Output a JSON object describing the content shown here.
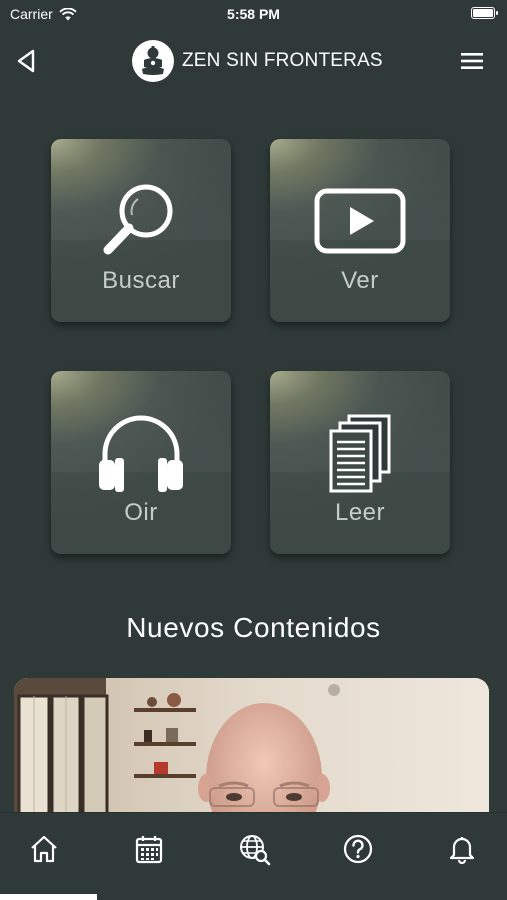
{
  "status_bar": {
    "carrier": "Carrier",
    "time": "5:58 PM"
  },
  "header": {
    "brand_title": "ZEN SIN FRONTERAS",
    "back_icon": "back-chevron-icon",
    "menu_icon": "hamburger-menu-icon"
  },
  "tiles": [
    {
      "label": "Buscar",
      "icon": "magnifier-icon"
    },
    {
      "label": "Ver",
      "icon": "play-icon"
    },
    {
      "label": "Oir",
      "icon": "headphones-icon"
    },
    {
      "label": "Leer",
      "icon": "documents-icon"
    }
  ],
  "section": {
    "title": "Nuevos Contenidos"
  },
  "tabbar": {
    "items": [
      "home-icon",
      "calendar-icon",
      "globe-search-icon",
      "help-icon",
      "bell-icon"
    ]
  },
  "colors": {
    "background": "#2f3a38",
    "tile_label": "#c7cccb",
    "tile_glow": "#a8ac8e"
  }
}
